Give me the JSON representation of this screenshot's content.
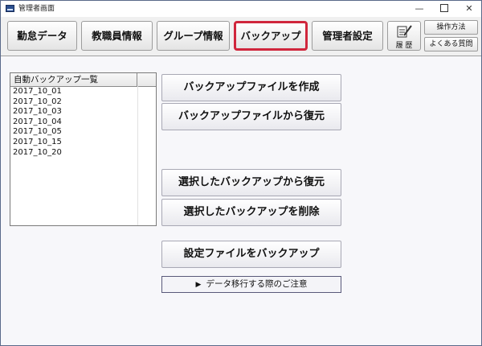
{
  "window": {
    "title": "管理者画面"
  },
  "titlebar": {
    "minimize": "—",
    "close": "✕"
  },
  "toolbar": {
    "tabs": [
      {
        "label": "勤怠データ"
      },
      {
        "label": "教職員情報"
      },
      {
        "label": "グループ情報"
      },
      {
        "label": "バックアップ",
        "active": true
      },
      {
        "label": "管理者設定"
      }
    ],
    "history_label": "履 歴",
    "history_icon": "notepad-pencil-icon",
    "help_label": "操作方法",
    "faq_label": "よくある質問"
  },
  "backup_list": {
    "header": "自動バックアップ一覧",
    "items": [
      "2017_10_01",
      "2017_10_02",
      "2017_10_03",
      "2017_10_04",
      "2017_10_05",
      "2017_10_15",
      "2017_10_20"
    ]
  },
  "actions": {
    "create_backup": "バックアップファイルを作成",
    "restore_from_file": "バックアップファイルから復元",
    "restore_selected": "選択したバックアップから復元",
    "delete_selected": "選択したバックアップを削除",
    "backup_settings": "設定ファイルをバックアップ"
  },
  "note": {
    "icon": "▶",
    "label": "データ移行する際のご注意"
  },
  "colors": {
    "active_tab_border": "#d0263c",
    "app_icon": "#2c4f8f"
  }
}
